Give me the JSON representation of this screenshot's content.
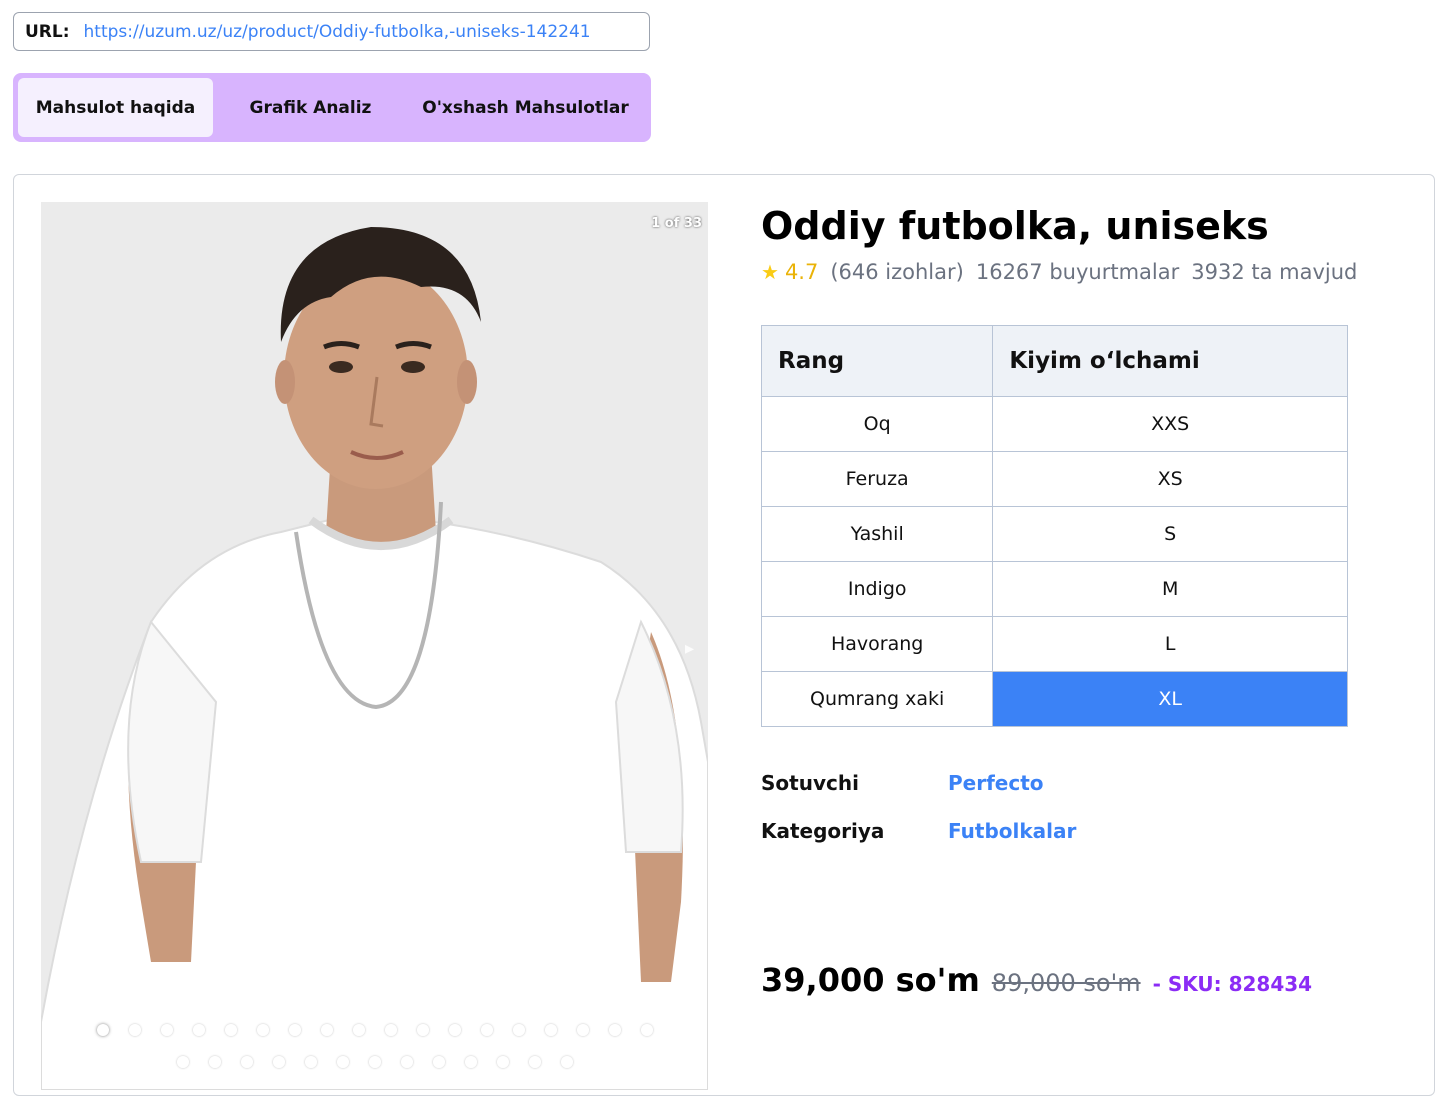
{
  "url_bar": {
    "label": "URL:",
    "value": "https://uzum.uz/uz/product/Oddiy-futbolka,-uniseks-142241"
  },
  "tabs": [
    {
      "label": "Mahsulot haqida",
      "active": true
    },
    {
      "label": "Grafik Analiz",
      "active": false
    },
    {
      "label": "O'xshash Mahsulotlar",
      "active": false
    }
  ],
  "gallery": {
    "counter": "1 of 33",
    "image_subject": "man-in-white-tshirt-photo",
    "next_icon": "chevron-right-icon",
    "dot_rows": [
      18,
      13
    ],
    "active_dot": 0
  },
  "product": {
    "title": "Oddiy futbolka, uniseks",
    "rating": "4.7",
    "reviews": "(646 izohlar)",
    "orders": "16267 buyurtmalar",
    "stock": "3932 ta mavjud"
  },
  "variants": {
    "headers": [
      "Rang",
      "Kiyim o‘lchami"
    ],
    "colors": [
      "Oq",
      "Feruza",
      "Yashil",
      "Indigo",
      "Havorang",
      "Qumrang xaki"
    ],
    "sizes": [
      "XXS",
      "XS",
      "S",
      "M",
      "L",
      "XL"
    ],
    "selected_size": "XL"
  },
  "attributes": [
    {
      "label": "Sotuvchi",
      "value": "Perfecto"
    },
    {
      "label": "Kategoriya",
      "value": "Futbolkalar"
    }
  ],
  "pricing": {
    "price": "39,000 so'm",
    "old_price": "89,000 so'm",
    "sku": "- SKU: 828434"
  },
  "colors": {
    "accent": "#3b82f6",
    "tabs_bg": "#d8b4fe",
    "sku": "#8b2cf5",
    "star": "#facc15"
  }
}
